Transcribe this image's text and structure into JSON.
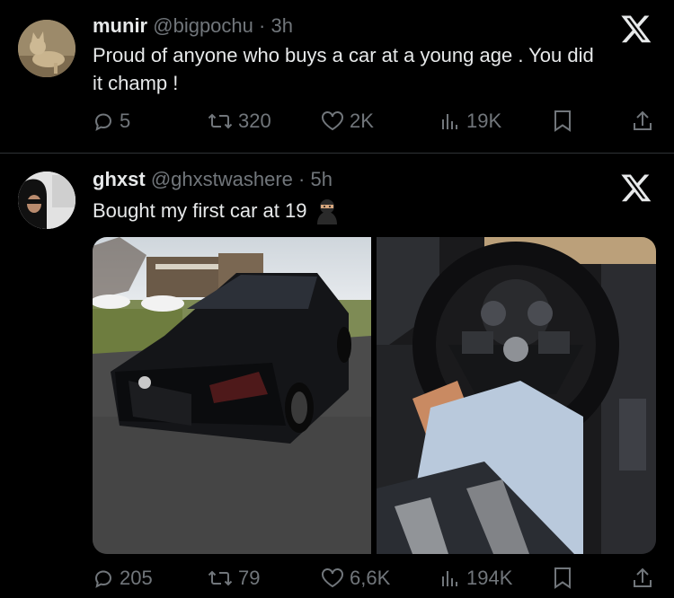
{
  "tweets": [
    {
      "name": "munir",
      "handle": "@bigpochu",
      "separator": "·",
      "time": "3h",
      "text_line1": "Proud of anyone who buys a car at a young age . You did",
      "text_line2": "it champ !",
      "stats": {
        "replies": "5",
        "reposts": "320",
        "likes": "2K",
        "views": "19K"
      },
      "avatar_icon": "cat-avatar-icon"
    },
    {
      "name": "ghxst",
      "handle": "@ghxstwashere",
      "separator": "·",
      "time": "5h",
      "text": "Bought my first car at 19",
      "emoji_icon": "ninja-emoji-icon",
      "stats": {
        "replies": "205",
        "reposts": "79",
        "likes": "6,6K",
        "views": "194K"
      },
      "media": [
        "black-sedan-photo",
        "steering-wheel-photo"
      ]
    }
  ],
  "icons": {
    "reply": "reply-icon",
    "repost": "repost-icon",
    "like": "heart-icon",
    "views": "views-chart-icon",
    "bookmark": "bookmark-icon",
    "share": "share-icon",
    "brand": "x-logo-icon"
  },
  "colors": {
    "background": "#000000",
    "text": "#e7e9ea",
    "secondary": "#71767b",
    "divider": "#2f3336"
  }
}
